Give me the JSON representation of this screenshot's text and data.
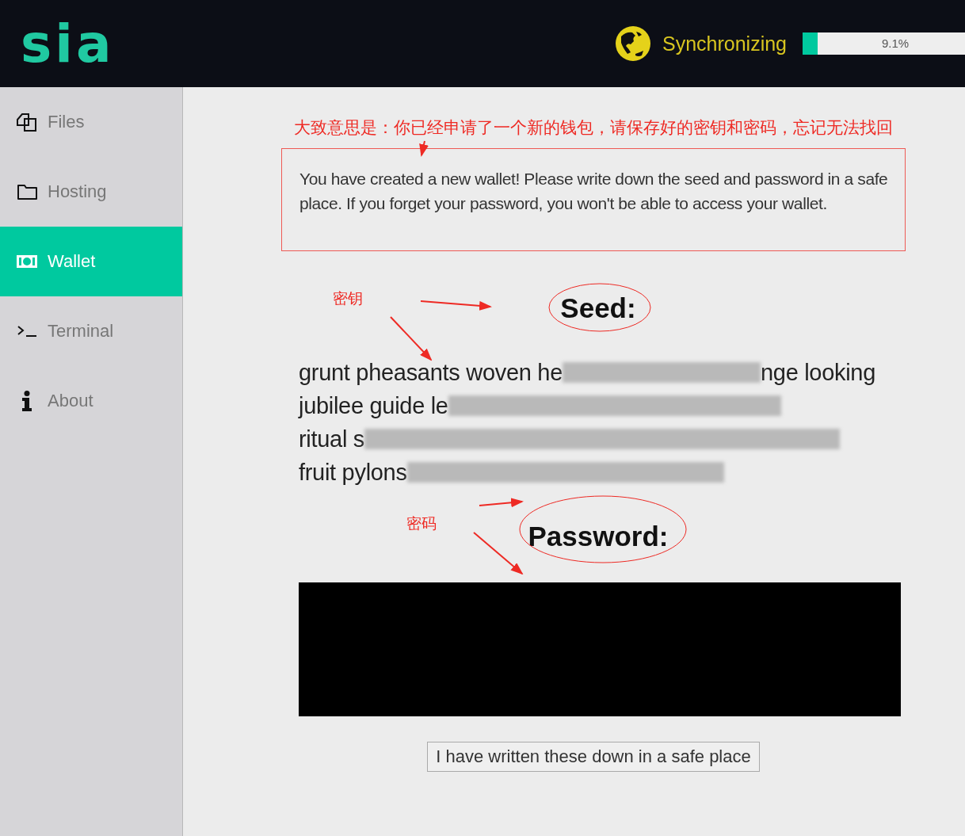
{
  "header": {
    "logo": "sia",
    "sync_status": "Synchronizing",
    "progress": {
      "level": 0.091,
      "reading": "9.1%"
    }
  },
  "sidebar": {
    "items": [
      {
        "label": "Files",
        "selected": false
      },
      {
        "label": "Hosting",
        "selected": false
      },
      {
        "label": "Wallet",
        "selected": true
      },
      {
        "label": "Terminal",
        "selected": false
      },
      {
        "label": "About",
        "selected": false
      }
    ]
  },
  "message": "You have created a new wallet! Please write down the seed and password in a safe place. If you forget your password, you won't be able to access your wallet.",
  "seed": {
    "heading": "Seed:",
    "lines": [
      [
        {
          "kind": "text",
          "text": "grunt pheasants woven he"
        },
        {
          "kind": "blur"
        },
        {
          "kind": "text",
          "text": "nge looking"
        }
      ],
      [
        {
          "kind": "text",
          "text": "jubilee guide le"
        },
        {
          "kind": "blur"
        }
      ],
      [
        {
          "kind": "text",
          "text": "ritual s"
        },
        {
          "kind": "blur"
        }
      ],
      [
        {
          "kind": "text",
          "text": "fruit pylons"
        },
        {
          "kind": "blur"
        }
      ]
    ]
  },
  "password": {
    "heading": "Password:",
    "value": {
      "kind": "redacted"
    }
  },
  "confirm_button": "I have written these down in a safe place",
  "annotations": {
    "note": "大致意思是：你已经申请了一个新的钱包，请保存好的密钥和密码，忘记无法找回",
    "seed_label": "密钥",
    "password_label": "密码"
  }
}
